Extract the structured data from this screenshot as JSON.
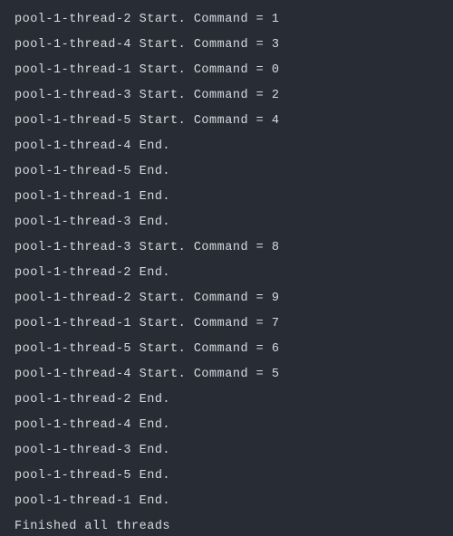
{
  "terminal": {
    "lines": [
      "pool-1-thread-2 Start. Command = 1",
      "pool-1-thread-4 Start. Command = 3",
      "pool-1-thread-1 Start. Command = 0",
      "pool-1-thread-3 Start. Command = 2",
      "pool-1-thread-5 Start. Command = 4",
      "pool-1-thread-4 End.",
      "pool-1-thread-5 End.",
      "pool-1-thread-1 End.",
      "pool-1-thread-3 End.",
      "pool-1-thread-3 Start. Command = 8",
      "pool-1-thread-2 End.",
      "pool-1-thread-2 Start. Command = 9",
      "pool-1-thread-1 Start. Command = 7",
      "pool-1-thread-5 Start. Command = 6",
      "pool-1-thread-4 Start. Command = 5",
      "pool-1-thread-2 End.",
      "pool-1-thread-4 End.",
      "pool-1-thread-3 End.",
      "pool-1-thread-5 End.",
      "pool-1-thread-1 End.",
      "Finished all threads"
    ]
  }
}
